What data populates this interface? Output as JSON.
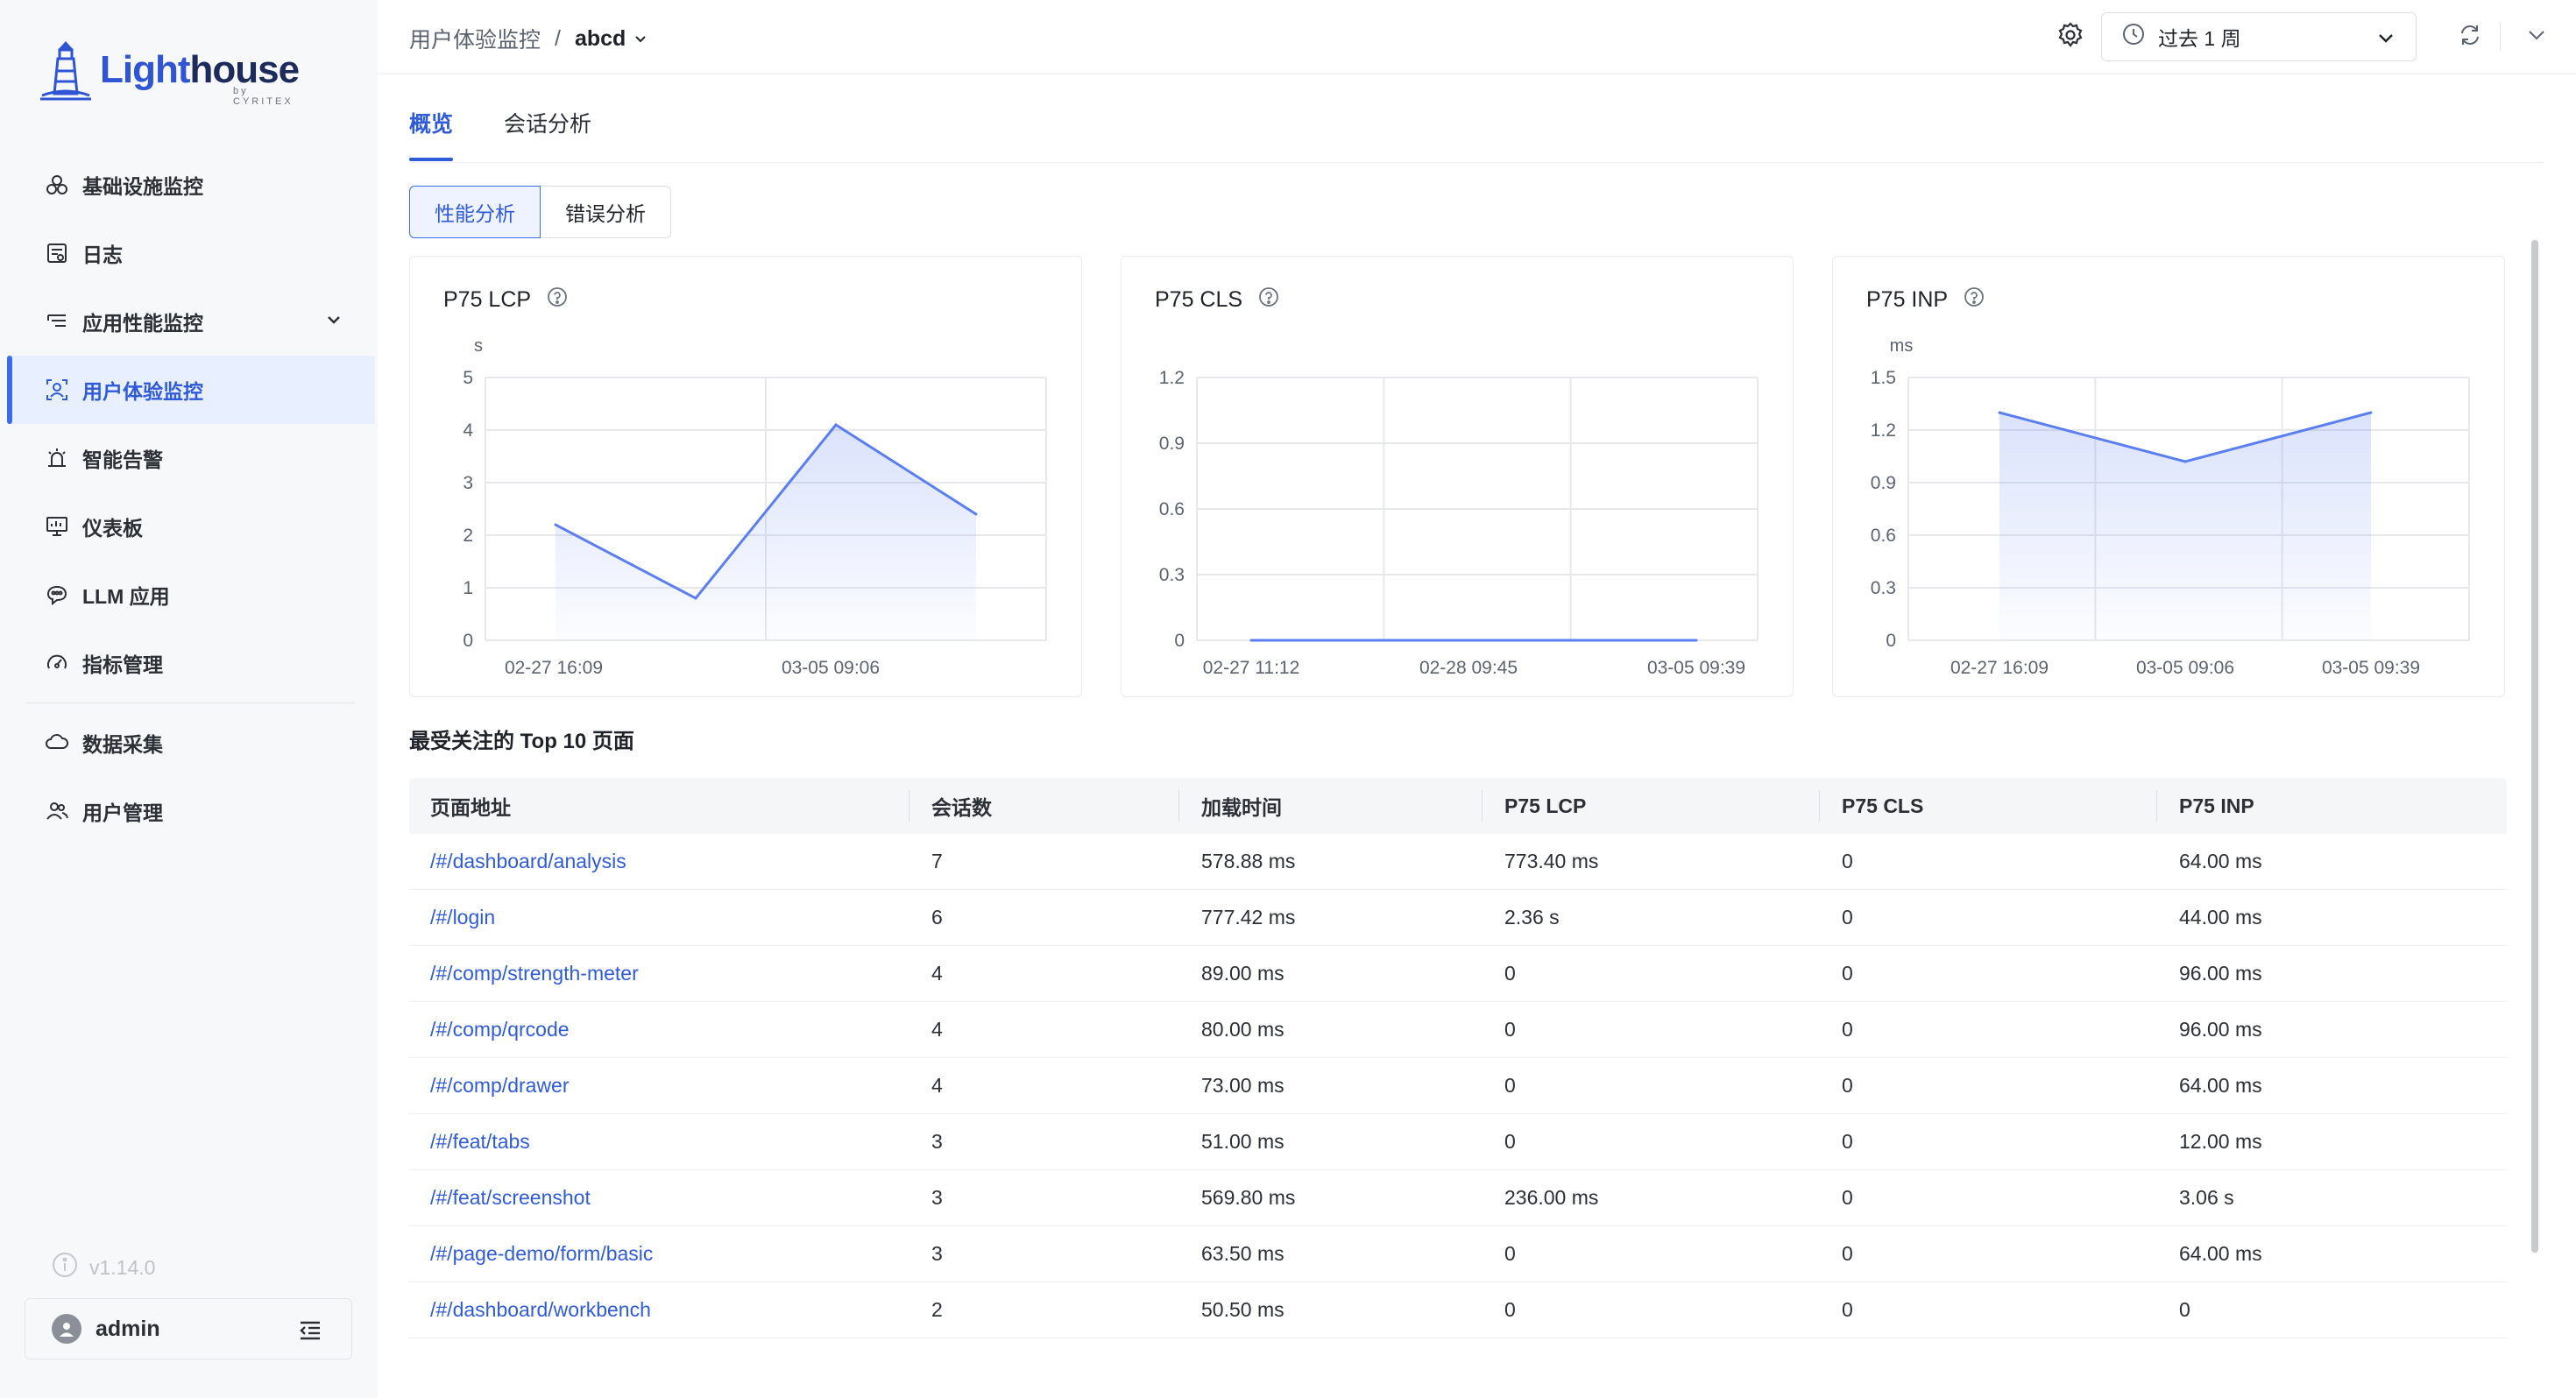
{
  "app": {
    "logo_light": "Light",
    "logo_house": "house",
    "logo_sub": "by CYRITEX"
  },
  "sidebar": {
    "items": [
      {
        "label": "基础设施监控",
        "icon": "infrastructure-icon"
      },
      {
        "label": "日志",
        "icon": "log-icon"
      },
      {
        "label": "应用性能监控",
        "icon": "apm-icon",
        "expandable": true
      },
      {
        "label": "用户体验监控",
        "icon": "user-experience-icon",
        "active": true
      },
      {
        "label": "智能告警",
        "icon": "alarm-icon"
      },
      {
        "label": "仪表板",
        "icon": "dashboard-icon"
      },
      {
        "label": "LLM 应用",
        "icon": "llm-icon"
      },
      {
        "label": "指标管理",
        "icon": "metric-icon"
      },
      {
        "label": "数据采集",
        "icon": "data-collection-icon"
      },
      {
        "label": "用户管理",
        "icon": "user-management-icon"
      }
    ],
    "version": "v1.14.0",
    "user": "admin"
  },
  "header": {
    "breadcrumb_parent": "用户体验监控",
    "breadcrumb_sep": "/",
    "breadcrumb_current": "abcd",
    "time_range": "过去 1 周"
  },
  "tabs": [
    {
      "label": "概览",
      "active": true
    },
    {
      "label": "会话分析"
    }
  ],
  "segments": [
    {
      "label": "性能分析",
      "active": true
    },
    {
      "label": "错误分析"
    }
  ],
  "chart_data": [
    {
      "type": "area",
      "title": "P75 LCP",
      "unit": "s",
      "y_ticks": [
        "0",
        "1",
        "2",
        "3",
        "4",
        "5"
      ],
      "ylim": [
        0,
        5
      ],
      "x_tick_labels": [
        "02-27 16:09",
        "03-05 09:06"
      ],
      "values": [
        2.2,
        0.8,
        4.1,
        2.4
      ],
      "color": "#5b7ff0"
    },
    {
      "type": "line",
      "title": "P75 CLS",
      "unit": "",
      "y_ticks": [
        "0",
        "0.3",
        "0.6",
        "0.9",
        "1.2"
      ],
      "ylim": [
        0,
        1.2
      ],
      "x_tick_labels": [
        "02-27 11:12",
        "02-28 09:45",
        "03-05 09:39"
      ],
      "values": [
        0,
        0,
        0
      ],
      "color": "#5b7ff0"
    },
    {
      "type": "area",
      "title": "P75 INP",
      "unit": "ms",
      "y_ticks": [
        "0",
        "0.3",
        "0.6",
        "0.9",
        "1.2",
        "1.5"
      ],
      "ylim": [
        0,
        1.5
      ],
      "x_tick_labels": [
        "02-27 16:09",
        "03-05 09:06",
        "03-05 09:39"
      ],
      "values": [
        1.3,
        1.02,
        1.3
      ],
      "color": "#5b7ff0"
    }
  ],
  "table": {
    "title": "最受关注的 Top 10 页面",
    "columns": [
      "页面地址",
      "会话数",
      "加载时间",
      "P75 LCP",
      "P75 CLS",
      "P75 INP"
    ],
    "rows": [
      [
        "/#/dashboard/analysis",
        "7",
        "578.88 ms",
        "773.40 ms",
        "0",
        "64.00 ms"
      ],
      [
        "/#/login",
        "6",
        "777.42 ms",
        "2.36 s",
        "0",
        "44.00 ms"
      ],
      [
        "/#/comp/strength-meter",
        "4",
        "89.00 ms",
        "0",
        "0",
        "96.00 ms"
      ],
      [
        "/#/comp/qrcode",
        "4",
        "80.00 ms",
        "0",
        "0",
        "96.00 ms"
      ],
      [
        "/#/comp/drawer",
        "4",
        "73.00 ms",
        "0",
        "0",
        "64.00 ms"
      ],
      [
        "/#/feat/tabs",
        "3",
        "51.00 ms",
        "0",
        "0",
        "12.00 ms"
      ],
      [
        "/#/feat/screenshot",
        "3",
        "569.80 ms",
        "236.00 ms",
        "0",
        "3.06 s"
      ],
      [
        "/#/page-demo/form/basic",
        "3",
        "63.50 ms",
        "0",
        "0",
        "64.00 ms"
      ],
      [
        "/#/dashboard/workbench",
        "2",
        "50.50 ms",
        "0",
        "0",
        "0"
      ]
    ]
  }
}
